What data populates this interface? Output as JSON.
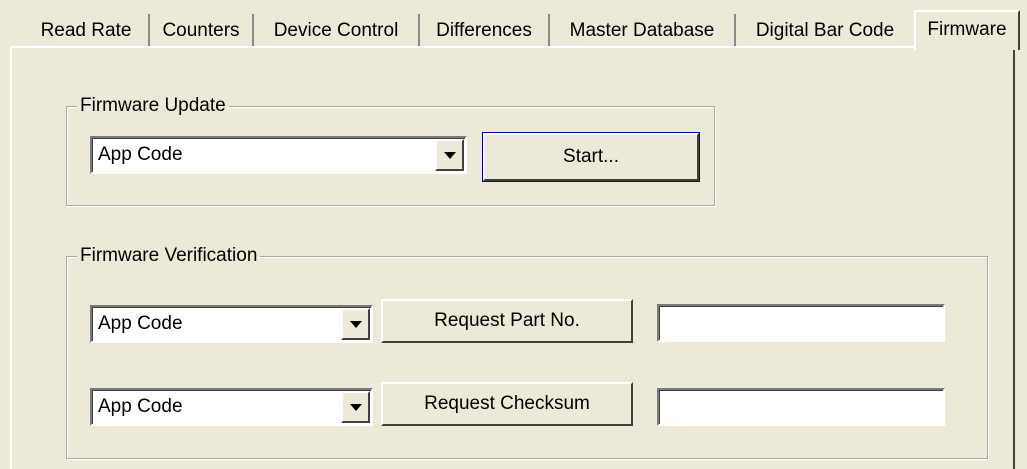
{
  "tabs": [
    {
      "label": "Read Rate"
    },
    {
      "label": "Counters"
    },
    {
      "label": "Device Control"
    },
    {
      "label": "Differences"
    },
    {
      "label": "Master Database"
    },
    {
      "label": "Digital Bar Code"
    },
    {
      "label": "Firmware",
      "active": true
    }
  ],
  "firmware_update": {
    "title": "Firmware Update",
    "code_select": "App Code",
    "start_label": "Start..."
  },
  "firmware_verification": {
    "title": "Firmware Verification",
    "part_row": {
      "code_select": "App Code",
      "button_label": "Request Part No.",
      "result_value": ""
    },
    "checksum_row": {
      "code_select": "App Code",
      "button_label": "Request Checksum",
      "result_value": ""
    }
  }
}
